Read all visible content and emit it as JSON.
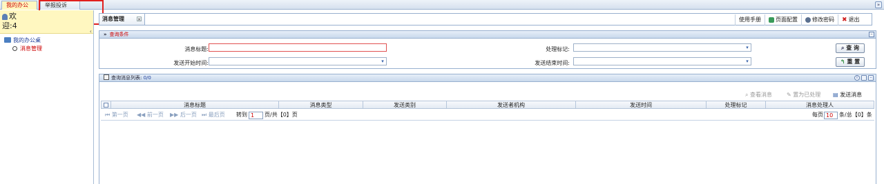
{
  "top_tabs": [
    {
      "label": "我的办公桌"
    },
    {
      "label": "举报投诉"
    }
  ],
  "collapse_glyph": "»",
  "left": {
    "welcome_line1": "欢",
    "welcome_line2": "迎:4",
    "tree_root": "我的办公桌",
    "tree_child": "消息管理"
  },
  "main_tab": {
    "label": "消息管理",
    "close": "×"
  },
  "toolbar": {
    "manual": "使用手册",
    "page_config": "页面配置",
    "change_password": "修改密码",
    "logout": "退出"
  },
  "query": {
    "title": "查询条件",
    "msg_title_label": "消息标题:",
    "flag_label": "处理标记:",
    "start_time_label": "发送开始时间:",
    "end_time_label": "发送结束时间:",
    "msg_title_value": "",
    "search_btn": "查 询",
    "reset_btn": "重 置"
  },
  "list": {
    "title": "查询消息列表:",
    "count": "0/0",
    "actions": {
      "view": "查看消息",
      "mark": "置为已处理",
      "send": "发送消息"
    },
    "columns": [
      "消息标题",
      "消息类型",
      "发送类别",
      "发送者机构",
      "发送时间",
      "处理标记",
      "消息处理人"
    ]
  },
  "pager": {
    "first": "第一页",
    "prev": "前一页",
    "next": "后一页",
    "last": "最后页",
    "goto_prefix": "转到",
    "goto_value": "1",
    "goto_suffix": "页/共【0】页",
    "per_page_prefix": "每页",
    "per_page_value": "10",
    "per_page_suffix": "条/总【0】条"
  },
  "colors": {
    "accent_red": "#cc0000",
    "link_blue": "#1f3f9a",
    "panel_border": "#98b0cf",
    "highlight_box": "#e0201e"
  },
  "icons": [
    "user-icon",
    "desk-icon",
    "circle-node-icon",
    "help-book-icon",
    "palette-icon",
    "key-icon",
    "exit-icon",
    "search-icon",
    "reset-icon",
    "list-icon",
    "send-icon",
    "first-page-icon",
    "prev-page-icon",
    "next-page-icon",
    "last-page-icon"
  ]
}
